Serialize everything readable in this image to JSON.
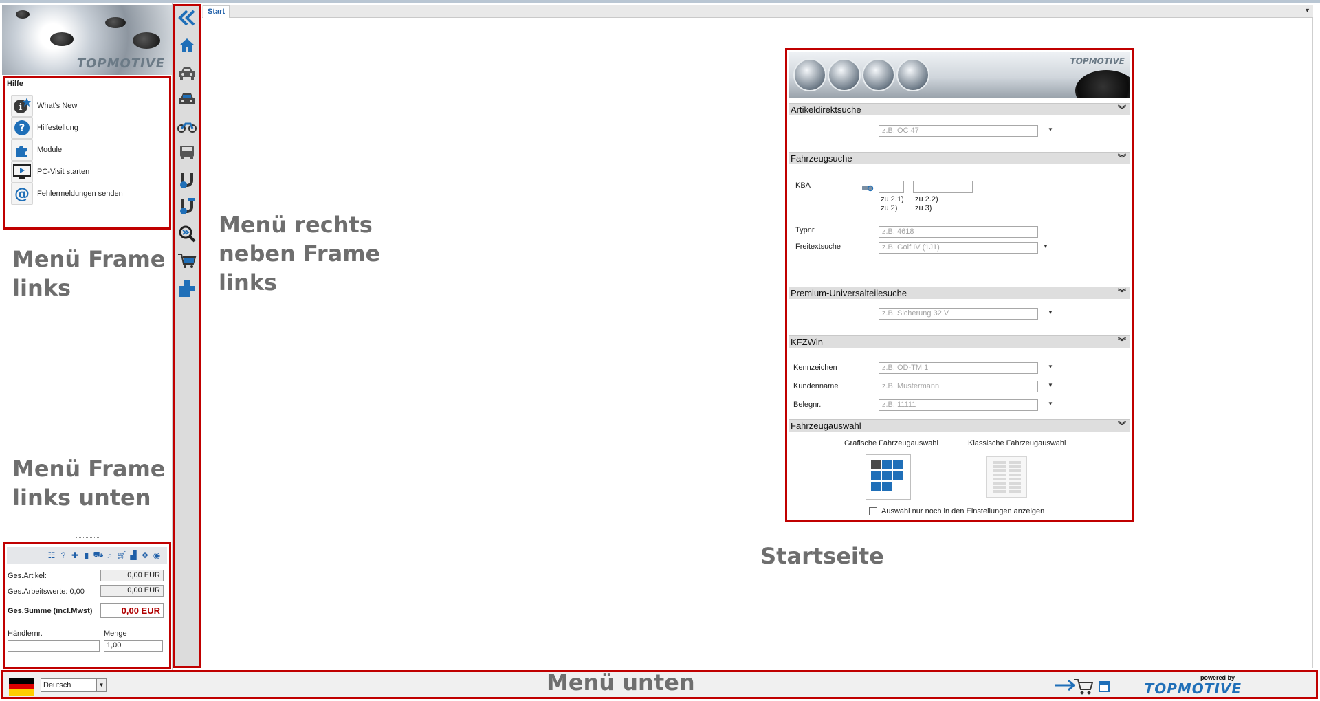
{
  "left_frame": {
    "logo_text": "TOPMOTIVE",
    "help": {
      "title": "Hilfe",
      "items": [
        {
          "label": "What's New",
          "icon": "info-star-icon"
        },
        {
          "label": "Hilfestellung",
          "icon": "question-icon"
        },
        {
          "label": "Module",
          "icon": "puzzle-icon"
        },
        {
          "label": "PC-Visit starten",
          "icon": "monitor-play-icon"
        },
        {
          "label": "Fehlermeldungen senden",
          "icon": "at-sign-icon"
        }
      ]
    },
    "overlay_top": [
      "Menü Frame",
      "links"
    ],
    "overlay_bottom": [
      "Menü Frame",
      "links unten"
    ],
    "summary": {
      "toolbar_icons": [
        "list-icon",
        "help-icon",
        "puzzle-icon",
        "book-icon",
        "truck-icon",
        "search-icon",
        "cart-icon",
        "factory-icon",
        "move-icon",
        "eye-icon"
      ],
      "ges_artikel_label": "Ges.Artikel:",
      "ges_artikel_value": "0,00 EUR",
      "ges_arbeitswerte_label": "Ges.Arbeitswerte: 0,00",
      "ges_arbeitswerte_value": "0,00 EUR",
      "ges_summe_label": "Ges.Summe (incl.Mwst)",
      "ges_summe_value": "0,00 EUR",
      "haendlernr_label": "Händlernr.",
      "haendlernr_value": "",
      "menge_label": "Menge",
      "menge_value": "1,00"
    }
  },
  "rail": {
    "icons": [
      "collapse-left-icon",
      "home-icon",
      "car-front-icon",
      "car-icon",
      "motorcycle-icon",
      "truck-icon",
      "magnet-icon",
      "magnet-alt-icon",
      "search-forward-icon",
      "cart-icon",
      "blocks-icon"
    ]
  },
  "overlay_rail": [
    "Menü rechts",
    "neben Frame",
    "links"
  ],
  "tabs": {
    "start": "Start"
  },
  "start_panel": {
    "brand": "TOPMOTIVE",
    "sections": {
      "artikel": "Artikeldirektsuche",
      "fahrzeug": "Fahrzeugsuche",
      "premium": "Premium-Universalteilesuche",
      "kfzwin": "KFZWin",
      "auswahl": "Fahrzeugauswahl"
    },
    "artikel_placeholder": "z.B. OC 47",
    "kba_label": "KBA",
    "kba_hint_1a": "zu 2.1)",
    "kba_hint_1b": "zu 2)",
    "kba_hint_2a": "zu 2.2)",
    "kba_hint_2b": "zu 3)",
    "typnr_label": "Typnr",
    "typnr_placeholder": "z.B. 4618",
    "freitext_label": "Freitextsuche",
    "freitext_placeholder": "z.B. Golf IV (1J1)",
    "premium_placeholder": "z.B. Sicherung 32 V",
    "kennzeichen_label": "Kennzeichen",
    "kennzeichen_placeholder": "z.B. OD-TM 1",
    "kundenname_label": "Kundenname",
    "kundenname_placeholder": "z.B. Mustermann",
    "belegnr_label": "Belegnr.",
    "belegnr_placeholder": "z.B. 11111",
    "grafische_label": "Grafische Fahrzeugauswahl",
    "klassische_label": "Klassische Fahrzeugauswahl",
    "checkbox_label": "Auswahl nur noch in den Einstellungen anzeigen"
  },
  "overlay_start": "Startseite",
  "bottom_bar": {
    "language": "Deutsch",
    "overlay": "Menü unten",
    "powered_by": "powered by",
    "brand": "TOPMOTIVE"
  },
  "colors": {
    "frame_red": "#c00000",
    "accent_blue": "#1f6fb8",
    "overlay_gray": "#6e6e6e"
  }
}
